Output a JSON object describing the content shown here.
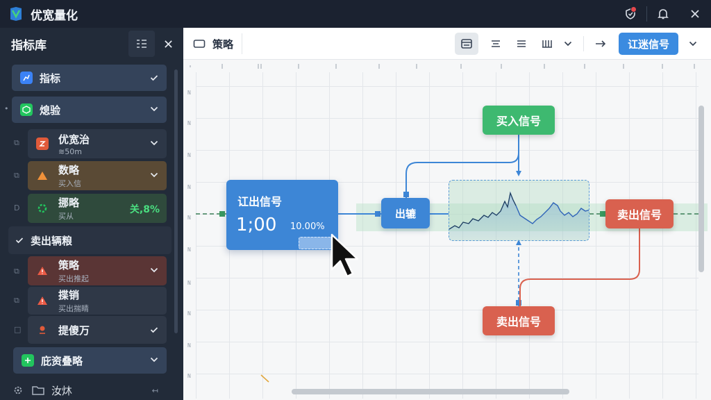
{
  "app": {
    "title": "优宽量化"
  },
  "sidebar": {
    "title": "指标库",
    "items": [
      {
        "label": "指标",
        "icon": "indicator-icon",
        "color": "#3b82f6"
      },
      {
        "label": "熄验",
        "icon": "cube-icon",
        "color": "#22c55e"
      }
    ],
    "subitems": [
      {
        "title": "优宽治",
        "subtitle": "≋50m",
        "icon": "strategy-icon",
        "color": "#e05a3a"
      },
      {
        "title": "数略",
        "subtitle": "买入信",
        "icon": "warning-icon",
        "color": "#f0913a"
      },
      {
        "title": "挪略",
        "subtitle": "买从",
        "value": "关,8%",
        "icon": "gear-icon",
        "color": "#22c55e"
      }
    ],
    "section": {
      "label": "卖出辆粮"
    },
    "section_items": [
      {
        "title": "策略",
        "subtitle": "买出推起",
        "icon": "warning-icon"
      },
      {
        "title": "揲销",
        "subtitle": "买出揣睛",
        "icon": "warning-icon"
      },
      {
        "title": "提傻万",
        "subtitle": ""
      }
    ],
    "bottom_item": {
      "label": "庇资叠略"
    },
    "footer": {
      "label": "汝炑",
      "extra": "↤"
    }
  },
  "toolbar": {
    "tab_label": "策略",
    "primary_button": "讧迷信号"
  },
  "canvas": {
    "main_node": {
      "title": "讧出信号",
      "value": "1;00",
      "percent": "10.00%"
    },
    "mid_node": {
      "label": "出辘"
    },
    "buy_node": {
      "label": "买入信号"
    },
    "sell_node_right": {
      "label": "卖出信号"
    },
    "sell_node_bottom": {
      "label": "卖出信号"
    }
  },
  "colors": {
    "accent": "#3b8be0",
    "buy": "#3eb970",
    "sell": "#d9614f",
    "sidebar": "#222b39"
  }
}
